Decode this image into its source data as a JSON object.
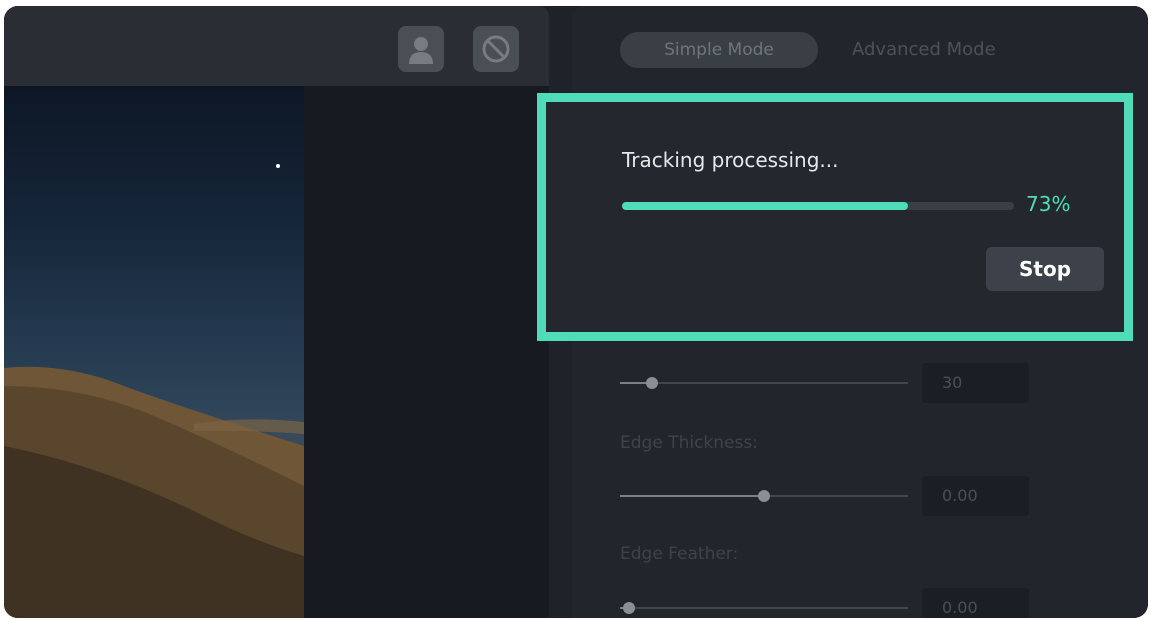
{
  "modes": {
    "simple_label": "Simple Mode",
    "advanced_label": "Advanced Mode",
    "active": "Simple Mode"
  },
  "toolbar": {
    "buttons": [
      {
        "icon": "portrait-icon"
      },
      {
        "icon": "no-entry-icon"
      }
    ]
  },
  "settings": {
    "slider_1": {
      "value": "30",
      "fraction": 0.11
    },
    "edge_thickness": {
      "label": "Edge Thickness:",
      "value": "0.00",
      "fraction": 0.5
    },
    "edge_feather": {
      "label": "Edge Feather:",
      "value": "0.00",
      "fraction": 0.03
    }
  },
  "tracking": {
    "title": "Tracking processing...",
    "progress_fraction": 0.73,
    "percent_text": "73%",
    "stop_label": "Stop"
  },
  "colors": {
    "accent": "#4fdcb8",
    "panel": "#22262c",
    "toolbar": "#2a2e34"
  }
}
